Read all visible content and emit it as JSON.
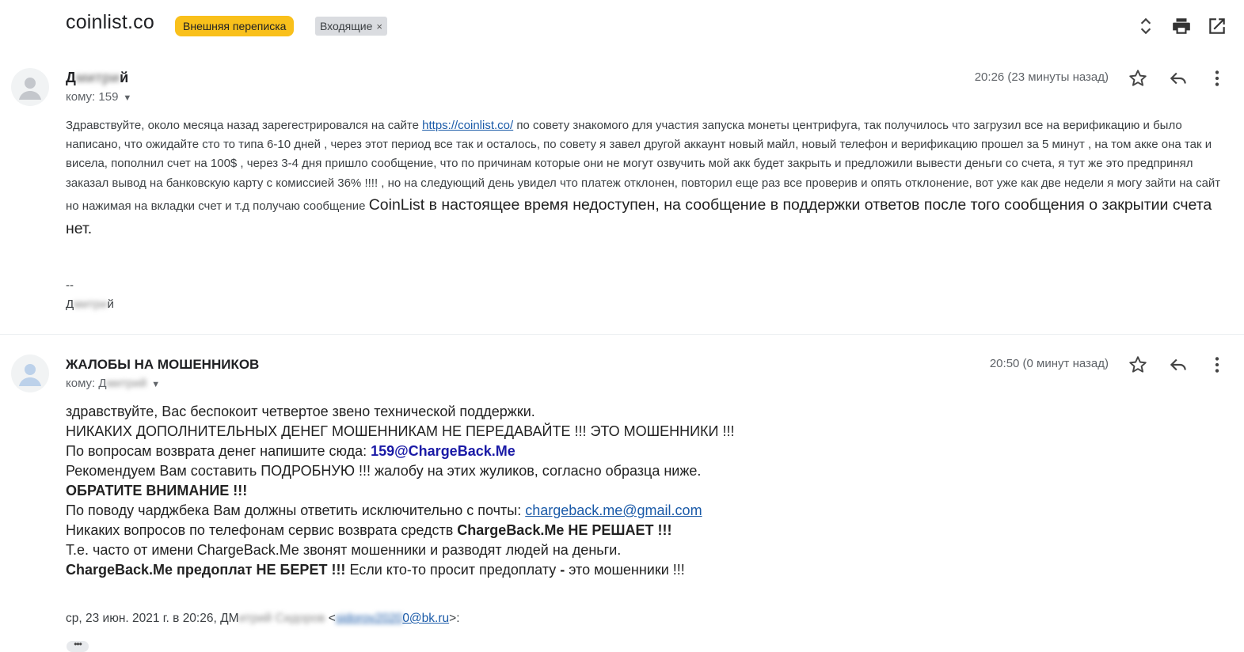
{
  "header": {
    "subject": "coinlist.co",
    "label_external": "Внешняя переписка",
    "label_inbox": "Входящие",
    "label_inbox_close": "×"
  },
  "toolbar": {
    "expand_icon": "unfold-more-icon",
    "print_icon": "print-icon",
    "new_window_icon": "open-in-new-icon"
  },
  "message1": {
    "sender_visible": "Д",
    "sender_blurred": "митри",
    "sender_end": "й",
    "to": "кому: 159",
    "time": "20:26 (23 минуты назад)",
    "body_pre": "Здравствуйте, около месяца назад зарегестрировался  на сайте ",
    "link": "https://coinlist.co/",
    "body_post": "  по совету знакомого для участия запуска монеты центрифуга, так получилось что загрузил все на верификацию и  было написано, что ожидайте сто то типа  6-10 дней , через этот период все так и осталось, по совету  я завел другой аккаунт новый майл, новый телефон и верификацию прошел за 5 минут  , на том акке она так и висела,  пополнил счет на 100$ , через 3-4 дня пришло сообщение, что по причинам которые они не могут озвучить мой  акк будет закрыть и предложили вывести деньги со счета, я тут же это предпринял заказал вывод на банковскую карту с комиссией 36% !!!! , но на следующий день увидел что платеж отклонен, повторил еще раз все проверив и опять отклонение, вот уже как две недели я могу зайти на сайт но нажимая на вкладки счет и т.д  получаю сообщение ",
    "body_big": "CoinList в настоящее время недоступен, на сообщение в поддержки ответов после того сообщения о закрытии счета нет.",
    "sig_dash": "--",
    "sig_visible": "Д",
    "sig_blurred": "митри",
    "sig_end": "й"
  },
  "message2": {
    "sender": "ЖАЛОБЫ НА МОШЕННИКОВ",
    "to_prefix": "кому: Д",
    "to_blurred": "митрий",
    "time": "20:50 (0 минут назад)",
    "lines": {
      "l1": "здравствуйте, Вас беспокоит четвертое звено технической поддержки.",
      "l2": "НИКАКИХ ДОПОЛНИТЕЛЬНЫХ ДЕНЕГ МОШЕННИКАМ НЕ ПЕРЕДАВАЙТЕ !!! ЭТО МОШЕННИКИ !!!",
      "l3_pre": "По вопросам возврата денег напишите сюда: ",
      "l3_email": "159@ChargeBack.Me",
      "l4": "Рекомендуем Вам составить ПОДРОБНУЮ !!! жалобу на этих жуликов, согласно образца ниже.",
      "l5": "ОБРАТИТЕ ВНИМАНИЕ !!!",
      "l6_pre": "По поводу чарджбека Вам должны ответить исключительно с почты: ",
      "l6_email": "chargeback.me@gmail.com",
      "l7_pre": "Никаких вопросов по телефонам сервис возврата средств ",
      "l7_bold": "ChargeBack.Me НЕ РЕШАЕТ !!!",
      "l8": "Т.е. часто от имени ChargeBack.Me звонят мошенники и разводят людей на деньги.",
      "l9_bold": "ChargeBack.Me предоплат НЕ БЕРЕТ !!!",
      "l9_mid": " Если кто-то просит предоплату ",
      "l9_dash": "-",
      "l9_post": " это мошенники !!!"
    },
    "quote_pre": "ср, 23 июн. 2021 г. в 20:26, ДМ",
    "quote_blur_name": "итрий Сидоров",
    "quote_lt": " <",
    "quote_blur_email": "sidorov2020",
    "quote_email_end": "0@bk.ru",
    "quote_post": ">:",
    "more": "•••"
  },
  "message_icons": {
    "avatar": "person-avatar-icon",
    "star": "star-icon",
    "reply": "reply-icon",
    "more": "more-vert-icon"
  }
}
